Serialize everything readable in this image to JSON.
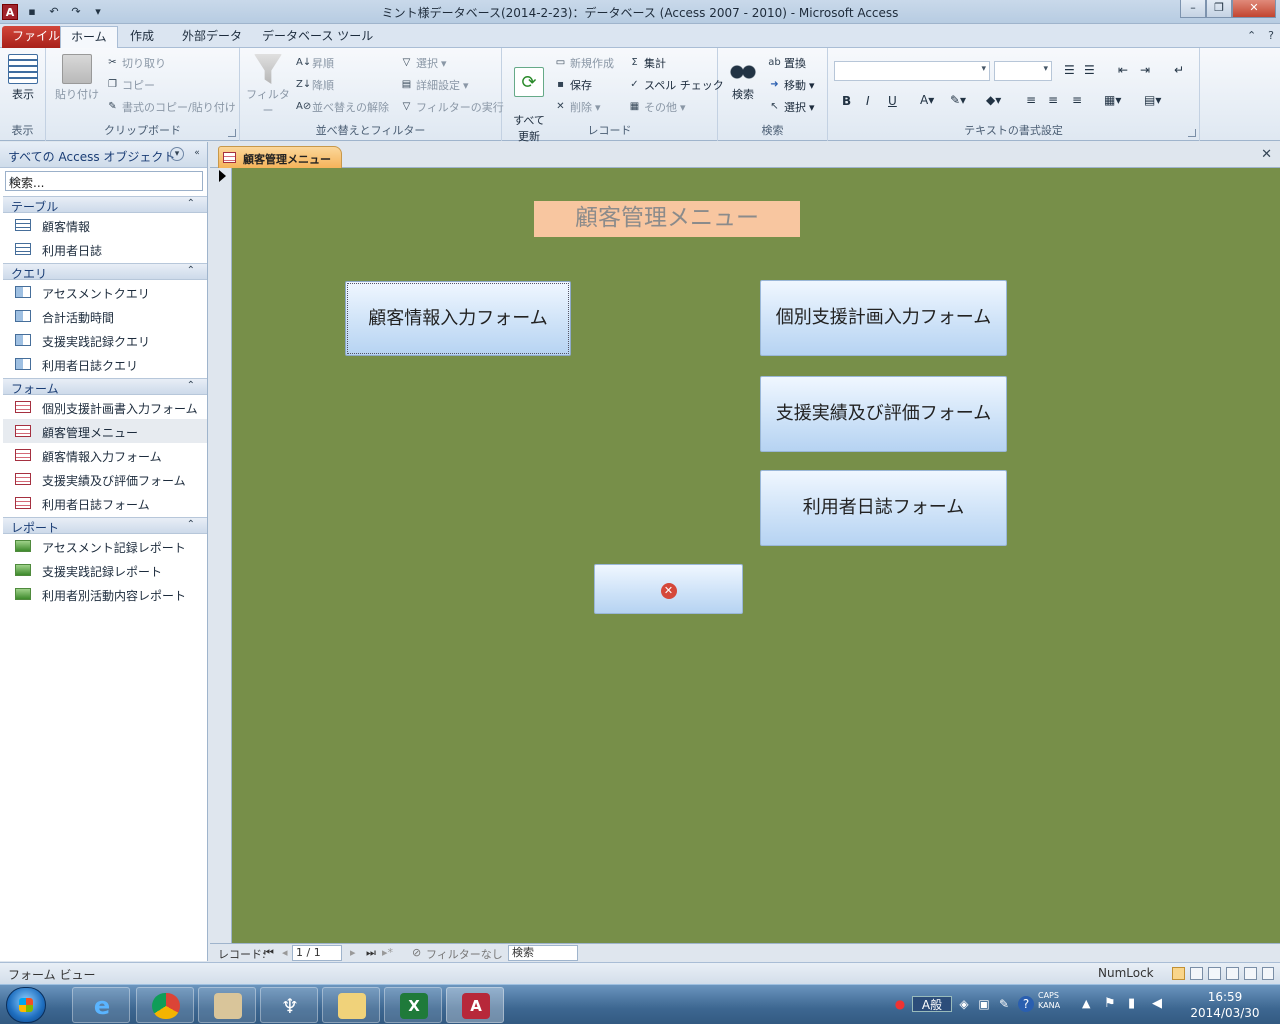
{
  "window": {
    "title": "ミント様データベース(2014-2-23)：データベース (Access 2007 - 2010) - Microsoft Access",
    "app_icon": "A"
  },
  "ribbon_tabs": [
    "ファイル",
    "ホーム",
    "作成",
    "外部データ",
    "データベース ツール"
  ],
  "ribbon": {
    "view": {
      "label": "表示",
      "group": "表示"
    },
    "clipboard": {
      "paste": "貼り付け",
      "cut": "切り取り",
      "copy": "コピー",
      "format_painter": "書式のコピー/貼り付け",
      "group": "クリップボード"
    },
    "sort_filter": {
      "filter": "フィルター",
      "asc": "昇順",
      "desc": "降順",
      "clear_sort": "並べ替えの解除",
      "selection": "選択",
      "advanced": "詳細設定",
      "toggle": "フィルターの実行",
      "group": "並べ替えとフィルター"
    },
    "records": {
      "refresh_all": "すべて\n更新",
      "new": "新規作成",
      "save": "保存",
      "delete": "削除",
      "totals": "集計",
      "spelling": "スペル チェック",
      "more": "その他",
      "group": "レコード"
    },
    "find": {
      "find": "検索",
      "replace": "置換",
      "goto": "移動",
      "select": "選択",
      "group": "検索"
    },
    "text_format": {
      "group": "テキストの書式設定",
      "bold": "B",
      "italic": "I",
      "underline": "U"
    }
  },
  "nav_pane": {
    "header": "すべての Access オブジェクト",
    "search_placeholder": "検索...",
    "sections": [
      {
        "title": "テーブル",
        "items": [
          "顧客情報",
          "利用者日誌"
        ]
      },
      {
        "title": "クエリ",
        "items": [
          "アセスメントクエリ",
          "合計活動時間",
          "支援実践記録クエリ",
          "利用者日誌クエリ"
        ]
      },
      {
        "title": "フォーム",
        "items": [
          "個別支援計画書入力フォーム",
          "顧客管理メニュー",
          "顧客情報入力フォーム",
          "支援実績及び評価フォーム",
          "利用者日誌フォーム"
        ]
      },
      {
        "title": "レポート",
        "items": [
          "アセスメント記録レポート",
          "支援実践記録レポート",
          "利用者別活動内容レポート"
        ]
      }
    ]
  },
  "document": {
    "tab_label": "顧客管理メニュー",
    "form_title": "顧客管理メニュー",
    "buttons": {
      "customer_info": "顧客情報入力フォーム",
      "support_plan": "個別支援計画入力フォーム",
      "support_eval": "支援実績及び評価フォーム",
      "user_diary": "利用者日誌フォーム",
      "close_glyph": "✕"
    },
    "colors": {
      "form_bg": "#778f49",
      "title_bg": "#f8c6a0"
    }
  },
  "record_nav": {
    "label": "レコード:",
    "position": "1 / 1",
    "filter": "フィルターなし",
    "search": "検索"
  },
  "status": {
    "left": "フォーム ビュー",
    "numlock": "NumLock"
  },
  "taskbar": {
    "clock_time": "16:59",
    "clock_date": "2014/03/30",
    "ime": "A般",
    "caps": "CAPS",
    "kana": "KANA"
  }
}
